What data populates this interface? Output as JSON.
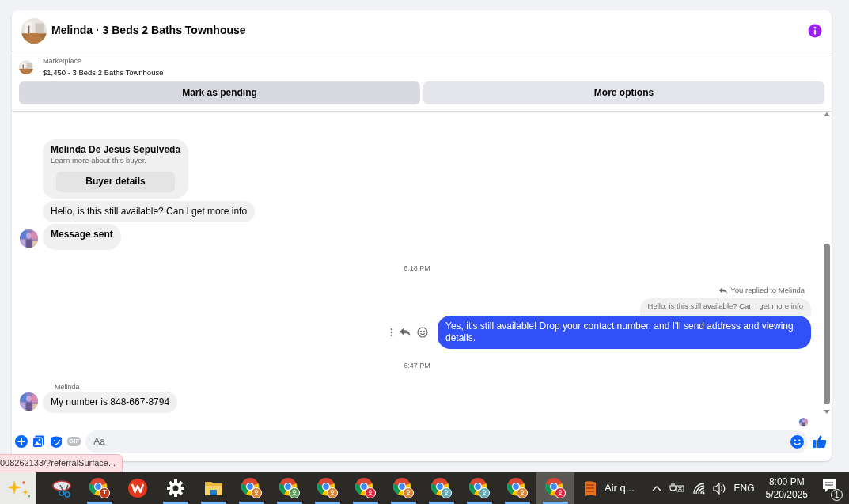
{
  "header": {
    "title": "Melinda · 3 Beds 2 Baths Townhouse"
  },
  "listing": {
    "source": "Marketplace",
    "summary": "$1,450 - 3 Beds 2 Baths Townhouse",
    "buttons": [
      {
        "label": "Mark as pending",
        "highlighted": true
      },
      {
        "label": "More options",
        "highlighted": false
      }
    ]
  },
  "messages": [
    {
      "kind": "buyer_card",
      "name": "Melinda De Jesus Sepulveda",
      "subtitle": "Learn more about this buyer.",
      "button": "Buyer details"
    },
    {
      "kind": "incoming",
      "text": "Hello, is this still available? Can I get more info",
      "avatar": false
    },
    {
      "kind": "notice",
      "text": "Message sent",
      "avatar": true
    },
    {
      "kind": "time",
      "text": "6:18 PM"
    },
    {
      "kind": "outgoing",
      "reply_label": "You replied to Melinda",
      "quoted": "Hello, is this still available? Can I get more info",
      "text": "Yes, it's still available! Drop your contact number, and I'll send address and viewing details."
    },
    {
      "kind": "time",
      "text": "6:47 PM"
    },
    {
      "kind": "incoming",
      "sender": "Melinda",
      "text": "My number is 848-667-8794",
      "avatar": true
    }
  ],
  "composer": {
    "gif_label": "GIF",
    "placeholder": "Aa"
  },
  "status_url": "008262133/?referralSurface...",
  "taskbar": {
    "items": [
      {
        "kind": "copilot",
        "running": false,
        "selected": false
      },
      {
        "kind": "snip",
        "running": false,
        "selected": false
      },
      {
        "kind": "chrome",
        "badge": "T",
        "color": "#c1391b",
        "running": true,
        "selected": false
      },
      {
        "kind": "wps",
        "running": false,
        "selected": false
      },
      {
        "kind": "settings",
        "running": true,
        "selected": false
      },
      {
        "kind": "folder",
        "running": true,
        "selected": false
      },
      {
        "kind": "chrome",
        "color": "#d9822b",
        "running": true,
        "selected": false
      },
      {
        "kind": "chrome",
        "color": "#5a9e5a",
        "running": true,
        "selected": false
      },
      {
        "kind": "chrome",
        "color": "#d9822b",
        "running": true,
        "selected": false
      },
      {
        "kind": "chrome",
        "color": "#e0203c",
        "running": true,
        "selected": false
      },
      {
        "kind": "chrome",
        "color": "#d9822b",
        "running": true,
        "selected": false
      },
      {
        "kind": "chrome",
        "color": "#5aa6b4",
        "running": true,
        "selected": false
      },
      {
        "kind": "chrome",
        "color": "#5aa6b4",
        "running": true,
        "selected": false
      },
      {
        "kind": "chrome",
        "color": "#d9822b",
        "running": true,
        "selected": false
      },
      {
        "kind": "chrome",
        "color": "#e0203c",
        "running": true,
        "selected": true
      }
    ],
    "weather": "Air q...",
    "language": "ENG",
    "time": "8:00 PM",
    "date": "5/20/2025",
    "notifications": "1"
  }
}
